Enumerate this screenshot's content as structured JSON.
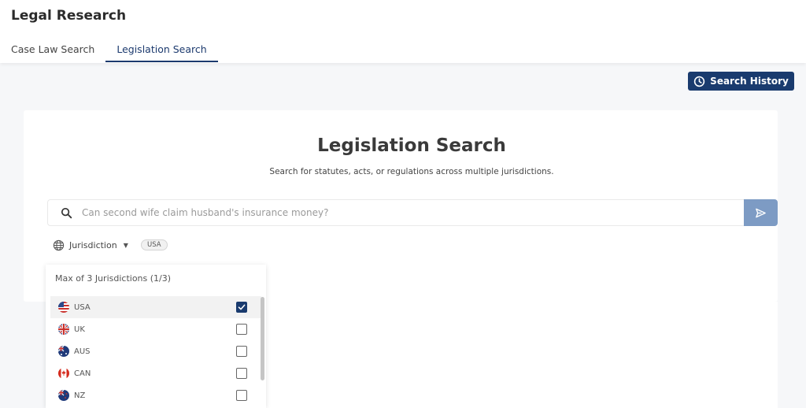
{
  "header": {
    "title": "Legal Research",
    "tabs": [
      {
        "label": "Case Law Search",
        "active": false
      },
      {
        "label": "Legislation Search",
        "active": true
      }
    ]
  },
  "actions": {
    "search_history_label": "Search History",
    "search_history_icon": "clock-icon"
  },
  "main": {
    "title": "Legislation Search",
    "subtitle": "Search for statutes, acts, or regulations across multiple jurisdictions.",
    "search": {
      "placeholder": "Can second wife claim husband's insurance money?",
      "value": "",
      "icon": "search-icon",
      "submit_icon": "send-icon"
    },
    "jurisdiction": {
      "label": "Jurisdiction",
      "selected_chips": [
        "USA"
      ],
      "dropdown": {
        "header": "Max of 3 Jurisdictions (1/3)",
        "options": [
          {
            "label": "USA",
            "checked": true
          },
          {
            "label": "UK",
            "checked": false
          },
          {
            "label": "AUS",
            "checked": false
          },
          {
            "label": "CAN",
            "checked": false
          },
          {
            "label": "NZ",
            "checked": false
          }
        ]
      }
    }
  },
  "colors": {
    "primary": "#1a3b6e",
    "send_button": "#7d9bc4",
    "background": "#f6f7f9"
  }
}
